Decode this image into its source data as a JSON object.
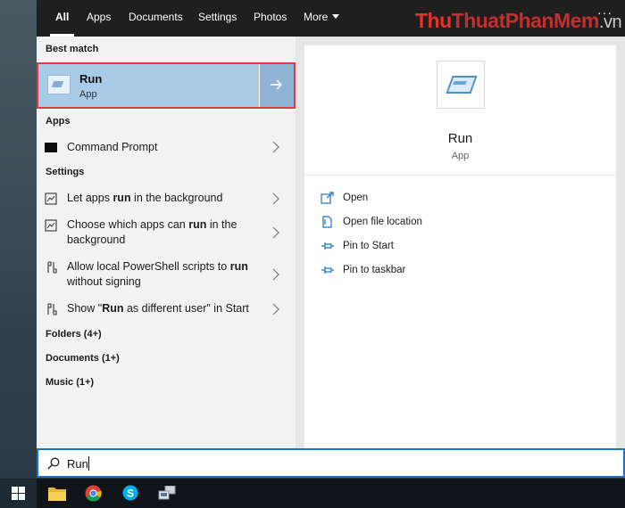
{
  "tabs": [
    {
      "label": "All",
      "active": true
    },
    {
      "label": "Apps"
    },
    {
      "label": "Documents"
    },
    {
      "label": "Settings"
    },
    {
      "label": "Photos"
    },
    {
      "label": "More"
    }
  ],
  "more_icon": "chevron-down-icon",
  "watermark": {
    "part1": "Thu",
    "part2": "ThuatPhanMem",
    "part3": ".vn"
  },
  "overflow_label": "···",
  "left": {
    "best_match_header": "Best match",
    "best_match": {
      "title": "Run",
      "subtitle": "App",
      "icon": "run-app-icon",
      "open_icon": "arrow-right-icon"
    },
    "apps_header": "Apps",
    "apps": [
      {
        "label": "Command Prompt",
        "icon": "command-prompt-icon"
      }
    ],
    "settings_header": "Settings",
    "settings": [
      {
        "pre": "Let apps ",
        "bold": "run",
        "post": " in the background",
        "icon": "settings-list-icon"
      },
      {
        "pre": "Choose which apps can ",
        "bold": "run",
        "post": " in the background",
        "icon": "settings-list-icon"
      },
      {
        "pre": "Allow local PowerShell scripts to ",
        "bold": "run",
        "post": " without signing",
        "icon": "settings-code-icon"
      },
      {
        "pre": "Show \"",
        "bold": "Run",
        "post": " as different user\" in Start",
        "icon": "settings-code-icon"
      }
    ],
    "folders": "Folders (4+)",
    "documents": "Documents (1+)",
    "music": "Music (1+)"
  },
  "right": {
    "title": "Run",
    "subtitle": "App",
    "icon": "run-app-icon",
    "actions": [
      {
        "label": "Open",
        "icon": "open-icon"
      },
      {
        "label": "Open file location",
        "icon": "file-location-icon"
      },
      {
        "label": "Pin to Start",
        "icon": "pin-icon"
      },
      {
        "label": "Pin to taskbar",
        "icon": "pin-icon"
      }
    ]
  },
  "search": {
    "value": "Run",
    "icon": "search-icon"
  },
  "taskbar": {
    "items": [
      "windows-start-icon",
      "file-explorer-icon",
      "chrome-icon",
      "skype-icon",
      "network-app-icon"
    ]
  },
  "colors": {
    "accent": "#1a73c4",
    "selection": "#a8cbe8",
    "highlight_border": "#e0393e",
    "topbar": "#1f1f1f"
  }
}
